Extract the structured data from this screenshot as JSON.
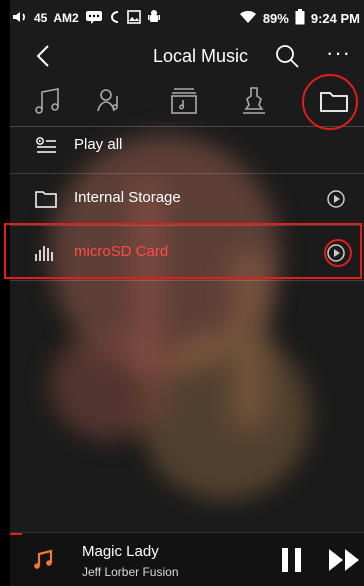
{
  "status_bar": {
    "volume_level": "45",
    "network_label": "AM2",
    "battery": "89%",
    "time": "9:24 PM"
  },
  "header": {
    "title": "Local Music",
    "icons": {
      "back": "chevron-left-icon",
      "search": "search-icon",
      "more": "more-dots-icon"
    }
  },
  "tabs": [
    {
      "name": "songs",
      "icon": "music-note-icon"
    },
    {
      "name": "artists",
      "icon": "artist-icon"
    },
    {
      "name": "albums",
      "icon": "album-icon"
    },
    {
      "name": "genres",
      "icon": "genre-icon"
    },
    {
      "name": "folders",
      "icon": "folder-icon",
      "selected": true
    }
  ],
  "list": {
    "play_all_label": "Play all",
    "items": [
      {
        "label": "Internal Storage",
        "icon": "folder-icon"
      },
      {
        "label": "microSD Card",
        "icon": "equalizer-bars-icon"
      }
    ]
  },
  "now_playing": {
    "title": "Magic Lady",
    "artist": "Jeff Lorber Fusion",
    "icons": {
      "track": "music-note-icon",
      "pause": "pause-icon",
      "next": "fast-forward-icon"
    }
  },
  "colors": {
    "accent": "#e11d1d",
    "selected_text": "#ff4a4a",
    "background": "#000000"
  }
}
